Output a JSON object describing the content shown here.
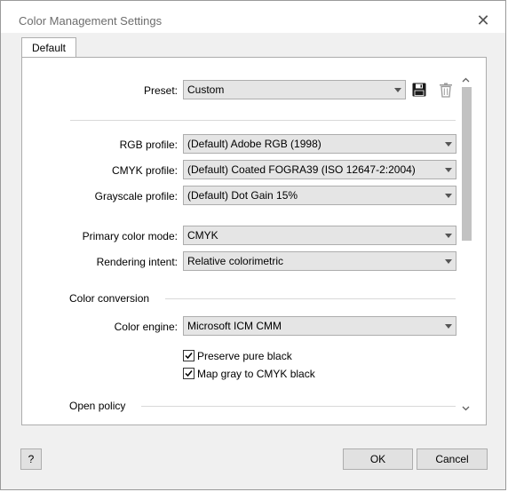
{
  "window": {
    "title": "Color Management Settings",
    "close_icon": "close-icon"
  },
  "tabs": [
    {
      "label": "Default",
      "active": true
    }
  ],
  "preset": {
    "label": "Preset:",
    "value": "Custom",
    "save_icon": "save-icon",
    "delete_icon": "trash-icon"
  },
  "profiles": {
    "rgb_label": "RGB profile:",
    "rgb_value": "(Default) Adobe RGB (1998)",
    "cmyk_label": "CMYK profile:",
    "cmyk_value": "(Default) Coated FOGRA39 (ISO 12647-2:2004)",
    "gray_label": "Grayscale profile:",
    "gray_value": "(Default) Dot Gain 15%"
  },
  "modes": {
    "primary_label": "Primary color mode:",
    "primary_value": "CMYK",
    "intent_label": "Rendering intent:",
    "intent_value": "Relative colorimetric"
  },
  "conversion": {
    "heading": "Color conversion",
    "engine_label": "Color engine:",
    "engine_value": "Microsoft ICM CMM",
    "preserve_black_label": "Preserve pure black",
    "preserve_black_checked": true,
    "map_gray_label": "Map gray to CMYK black",
    "map_gray_checked": true
  },
  "policy": {
    "heading": "Open policy"
  },
  "footer": {
    "help_label": "?",
    "ok_label": "OK",
    "cancel_label": "Cancel"
  }
}
